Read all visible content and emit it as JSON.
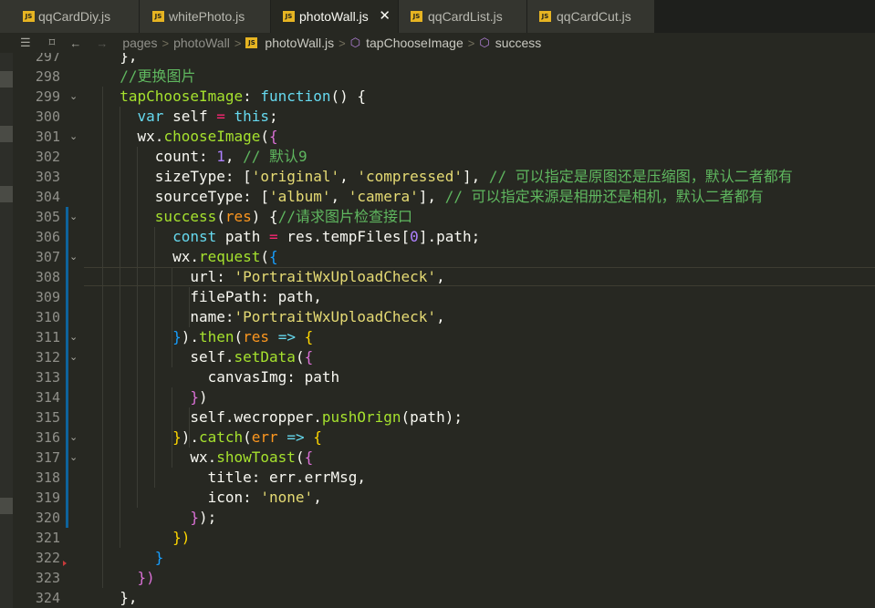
{
  "tabs": [
    {
      "label": "qqCardDiy.js",
      "active": false
    },
    {
      "label": "whitePhoto.js",
      "active": false
    },
    {
      "label": "photoWall.js",
      "active": true
    },
    {
      "label": "qqCardList.js",
      "active": false
    },
    {
      "label": "qqCardCut.js",
      "active": false
    }
  ],
  "tab_close_glyph": "✕",
  "js_badge": "JS",
  "breadcrumb": {
    "items": [
      "pages",
      "photoWall",
      "photoWall.js",
      "tapChooseImage",
      "success"
    ],
    "separator": ">",
    "nav_back": "←",
    "nav_forward": "→",
    "list_icon": "☰",
    "bookmark_icon": "⌑"
  },
  "colors": {
    "keyword": "#66d9ef",
    "function": "#a6e22e",
    "string": "#e6db74",
    "number": "#ae81ff",
    "comment": "#5fb75f",
    "param": "#fd971f",
    "operator": "#f92672",
    "git_modified": "#0e639c"
  },
  "editor": {
    "lines": [
      {
        "n": "297",
        "tokens": [
          [
            "  ",
            "t-white"
          ],
          [
            "},",
            "t-punc"
          ]
        ]
      },
      {
        "n": "298",
        "tokens": [
          [
            "  ",
            "t-white"
          ],
          [
            "//更换图片",
            "t-comment"
          ]
        ]
      },
      {
        "n": "299",
        "tokens": [
          [
            "  ",
            "t-white"
          ],
          [
            "tapChooseImage",
            "t-green"
          ],
          [
            ": ",
            "t-white"
          ],
          [
            "function",
            "t-blue"
          ],
          [
            "() {",
            "t-white"
          ]
        ],
        "fold": true
      },
      {
        "n": "300",
        "tokens": [
          [
            "    ",
            "t-white"
          ],
          [
            "var",
            "t-blue"
          ],
          [
            " self ",
            "t-white"
          ],
          [
            "=",
            "t-pink"
          ],
          [
            " ",
            "t-white"
          ],
          [
            "this",
            "t-blue"
          ],
          [
            ";",
            "t-white"
          ]
        ]
      },
      {
        "n": "301",
        "tokens": [
          [
            "    ",
            "t-white"
          ],
          [
            "wx",
            "t-white"
          ],
          [
            ".",
            "t-white"
          ],
          [
            "chooseImage",
            "t-green"
          ],
          [
            "(",
            "t-white"
          ],
          [
            "{",
            "t-purpleb"
          ]
        ],
        "fold": true
      },
      {
        "n": "302",
        "tokens": [
          [
            "      ",
            "t-white"
          ],
          [
            "count",
            "t-prop"
          ],
          [
            ": ",
            "t-white"
          ],
          [
            "1",
            "t-num"
          ],
          [
            ", ",
            "t-white"
          ],
          [
            "// 默认9",
            "t-comment"
          ]
        ]
      },
      {
        "n": "303",
        "tokens": [
          [
            "      ",
            "t-white"
          ],
          [
            "sizeType",
            "t-prop"
          ],
          [
            ": [",
            "t-white"
          ],
          [
            "'original'",
            "t-string"
          ],
          [
            ", ",
            "t-white"
          ],
          [
            "'compressed'",
            "t-string"
          ],
          [
            "], ",
            "t-white"
          ],
          [
            "// 可以指定是原图还是压缩图，默认二者都有",
            "t-comment"
          ]
        ]
      },
      {
        "n": "304",
        "tokens": [
          [
            "      ",
            "t-white"
          ],
          [
            "sourceType",
            "t-prop"
          ],
          [
            ": [",
            "t-white"
          ],
          [
            "'album'",
            "t-string"
          ],
          [
            ", ",
            "t-white"
          ],
          [
            "'camera'",
            "t-string"
          ],
          [
            "], ",
            "t-white"
          ],
          [
            "// 可以指定来源是相册还是相机，默认二者都有",
            "t-comment"
          ]
        ]
      },
      {
        "n": "305",
        "tokens": [
          [
            "      ",
            "t-white"
          ],
          [
            "success",
            "t-green"
          ],
          [
            "(",
            "t-white"
          ],
          [
            "res",
            "t-orange"
          ],
          [
            ") {",
            "t-white"
          ],
          [
            "//请求图片检查接口",
            "t-comment"
          ]
        ],
        "fold": true,
        "git": true
      },
      {
        "n": "306",
        "tokens": [
          [
            "        ",
            "t-white"
          ],
          [
            "const",
            "t-blue"
          ],
          [
            " path ",
            "t-white"
          ],
          [
            "=",
            "t-pink"
          ],
          [
            " res.tempFiles[",
            "t-white"
          ],
          [
            "0",
            "t-num"
          ],
          [
            "].path;",
            "t-white"
          ]
        ],
        "git": true
      },
      {
        "n": "307",
        "tokens": [
          [
            "        ",
            "t-white"
          ],
          [
            "wx",
            "t-white"
          ],
          [
            ".",
            "t-white"
          ],
          [
            "request",
            "t-green"
          ],
          [
            "(",
            "t-white"
          ],
          [
            "{",
            "t-blueb"
          ]
        ],
        "fold": true,
        "git": true
      },
      {
        "n": "308",
        "tokens": [
          [
            "          ",
            "t-white"
          ],
          [
            "url",
            "t-prop"
          ],
          [
            ": ",
            "t-white"
          ],
          [
            "'PortraitWxUploadCheck'",
            "t-string"
          ],
          [
            ",",
            "t-white"
          ]
        ],
        "git": true,
        "highlight": true
      },
      {
        "n": "309",
        "tokens": [
          [
            "          ",
            "t-white"
          ],
          [
            "filePath",
            "t-prop"
          ],
          [
            ": path,",
            "t-white"
          ]
        ],
        "git": true
      },
      {
        "n": "310",
        "tokens": [
          [
            "          ",
            "t-white"
          ],
          [
            "name",
            "t-prop"
          ],
          [
            ":",
            "t-white"
          ],
          [
            "'PortraitWxUploadCheck'",
            "t-string"
          ],
          [
            ",",
            "t-white"
          ]
        ],
        "git": true
      },
      {
        "n": "311",
        "tokens": [
          [
            "        ",
            "t-white"
          ],
          [
            "}",
            "t-blueb"
          ],
          [
            ").",
            "t-white"
          ],
          [
            "then",
            "t-green"
          ],
          [
            "(",
            "t-white"
          ],
          [
            "res",
            "t-orange"
          ],
          [
            " ",
            "t-white"
          ],
          [
            "=>",
            "t-blue"
          ],
          [
            " ",
            "t-white"
          ],
          [
            "{",
            "t-yellowb"
          ]
        ],
        "fold": true,
        "git": true
      },
      {
        "n": "312",
        "tokens": [
          [
            "          ",
            "t-white"
          ],
          [
            "self",
            "t-white"
          ],
          [
            ".",
            "t-white"
          ],
          [
            "setData",
            "t-green"
          ],
          [
            "(",
            "t-white"
          ],
          [
            "{",
            "t-purpleb"
          ]
        ],
        "fold": true,
        "git": true
      },
      {
        "n": "313",
        "tokens": [
          [
            "            ",
            "t-white"
          ],
          [
            "canvasImg",
            "t-prop"
          ],
          [
            ": path",
            "t-white"
          ]
        ],
        "git": true
      },
      {
        "n": "314",
        "tokens": [
          [
            "          ",
            "t-white"
          ],
          [
            "}",
            "t-purpleb"
          ],
          [
            ")",
            "t-white"
          ]
        ],
        "git": true
      },
      {
        "n": "315",
        "tokens": [
          [
            "          ",
            "t-white"
          ],
          [
            "self.wecropper.",
            "t-white"
          ],
          [
            "pushOrign",
            "t-green"
          ],
          [
            "(path);",
            "t-white"
          ]
        ],
        "git": true
      },
      {
        "n": "316",
        "tokens": [
          [
            "        ",
            "t-white"
          ],
          [
            "}",
            "t-yellowb"
          ],
          [
            ").",
            "t-white"
          ],
          [
            "catch",
            "t-green"
          ],
          [
            "(",
            "t-white"
          ],
          [
            "err",
            "t-orange"
          ],
          [
            " ",
            "t-white"
          ],
          [
            "=>",
            "t-blue"
          ],
          [
            " ",
            "t-white"
          ],
          [
            "{",
            "t-yellowb"
          ]
        ],
        "fold": true,
        "git": true
      },
      {
        "n": "317",
        "tokens": [
          [
            "          ",
            "t-white"
          ],
          [
            "wx",
            "t-white"
          ],
          [
            ".",
            "t-white"
          ],
          [
            "showToast",
            "t-green"
          ],
          [
            "(",
            "t-white"
          ],
          [
            "{",
            "t-purpleb"
          ]
        ],
        "fold": true,
        "git": true
      },
      {
        "n": "318",
        "tokens": [
          [
            "            ",
            "t-white"
          ],
          [
            "title",
            "t-prop"
          ],
          [
            ": err.errMsg,",
            "t-white"
          ]
        ],
        "git": true
      },
      {
        "n": "319",
        "tokens": [
          [
            "            ",
            "t-white"
          ],
          [
            "icon",
            "t-prop"
          ],
          [
            ": ",
            "t-white"
          ],
          [
            "'none'",
            "t-string"
          ],
          [
            ",",
            "t-white"
          ]
        ],
        "git": true
      },
      {
        "n": "320",
        "tokens": [
          [
            "          ",
            "t-white"
          ],
          [
            "}",
            "t-purpleb"
          ],
          [
            ");",
            "t-white"
          ]
        ],
        "git": true
      },
      {
        "n": "321",
        "tokens": [
          [
            "        ",
            "t-white"
          ],
          [
            "})",
            "t-yellowb"
          ]
        ]
      },
      {
        "n": "322",
        "tokens": [
          [
            "      ",
            "t-white"
          ],
          [
            "}",
            "t-blueb"
          ]
        ],
        "deleted": true
      },
      {
        "n": "323",
        "tokens": [
          [
            "    ",
            "t-white"
          ],
          [
            "})",
            "t-purpleb"
          ]
        ]
      },
      {
        "n": "324",
        "tokens": [
          [
            "  ",
            "t-white"
          ],
          [
            "},",
            "t-white"
          ]
        ]
      }
    ]
  }
}
